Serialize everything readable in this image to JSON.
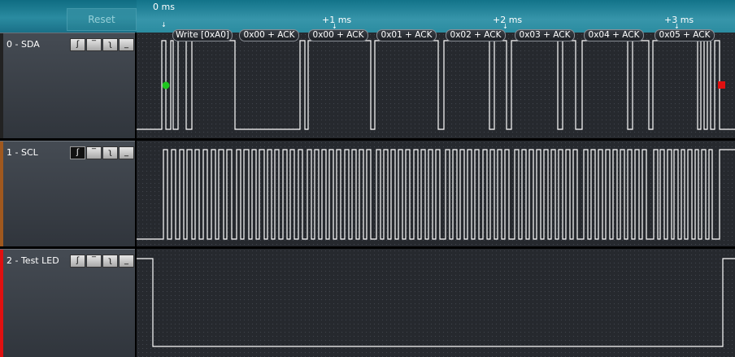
{
  "topbar": {
    "reset_label": "Reset"
  },
  "timeline": {
    "ticks": [
      "0 ms",
      "+1 ms",
      "+2 ms",
      "+3 ms"
    ]
  },
  "i2c_labels": [
    "Write [0xA0]",
    "0x00 + ACK",
    "0x00 + ACK",
    "0x01 + ACK",
    "0x02 + ACK",
    "0x03 + ACK",
    "0x04 + ACK",
    "0x05 + ACK"
  ],
  "channels": [
    {
      "name": "0 - SDA",
      "accent": "#222222"
    },
    {
      "name": "1 - SCL",
      "accent": "#a0581e"
    },
    {
      "name": "2 - Test LED",
      "accent": "#e01010"
    }
  ],
  "trigger_buttons": [
    "rising-edge",
    "high",
    "falling-edge",
    "low"
  ],
  "markers": {
    "start_color": "#1ec81e",
    "stop_color": "#e01010"
  },
  "signal_color": "#ffffff"
}
